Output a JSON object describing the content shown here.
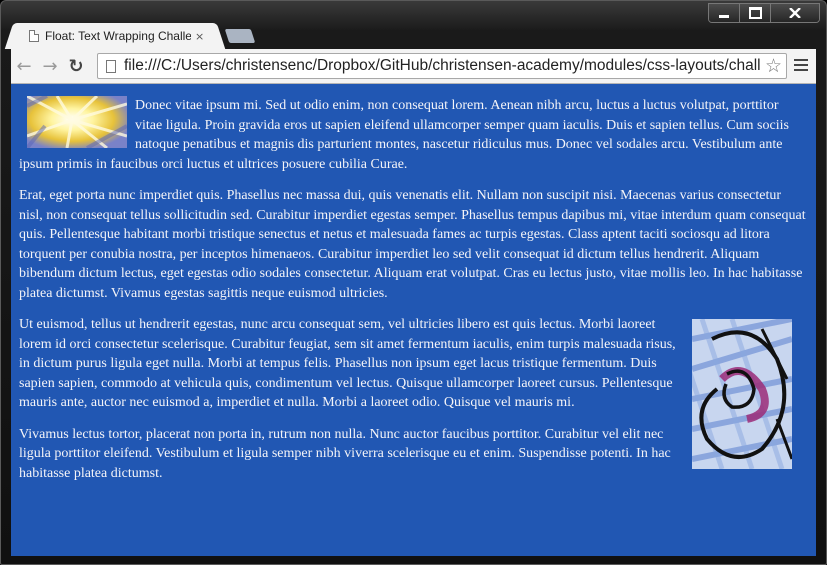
{
  "window": {
    "controls": {
      "minimize": "minimize",
      "maximize": "maximize",
      "close": "close"
    }
  },
  "tabs": [
    {
      "title": "Float: Text Wrapping Challe",
      "close": "×"
    }
  ],
  "toolbar": {
    "back": "←",
    "forward": "→",
    "reload": "↻",
    "url": "file:///C:/Users/christensenc/Dropbox/GitHub/christensen-academy/modules/css-layouts/chall",
    "bookmark": "☆"
  },
  "page": {
    "paragraphs": [
      "Donec vitae ipsum mi. Sed ut odio enim, non consequat lorem. Aenean nibh arcu, luctus a luctus volutpat, porttitor vitae ligula. Proin gravida eros ut sapien eleifend ullamcorper semper quam iaculis. Duis et sapien tellus. Cum sociis natoque penatibus et magnis dis parturient montes, nascetur ridiculus mus. Donec vel sodales arcu. Vestibulum ante ipsum primis in faucibus orci luctus et ultrices posuere cubilia Curae.",
      "Erat, eget porta nunc imperdiet quis. Phasellus nec massa dui, quis venenatis elit. Nullam non suscipit nisi. Maecenas varius consectetur nisl, non consequat tellus sollicitudin sed. Curabitur imperdiet egestas semper. Phasellus tempus dapibus mi, vitae interdum quam consequat quis. Pellentesque habitant morbi tristique senectus et netus et malesuada fames ac turpis egestas. Class aptent taciti sociosqu ad litora torquent per conubia nostra, per inceptos himenaeos. Curabitur imperdiet leo sed velit consequat id dictum tellus hendrerit. Aliquam bibendum dictum lectus, eget egestas odio sodales consectetur. Aliquam erat volutpat. Cras eu lectus justo, vitae mollis leo. In hac habitasse platea dictumst. Vivamus egestas sagittis neque euismod ultricies.",
      "Ut euismod, tellus ut hendrerit egestas, nunc arcu consequat sem, vel ultricies libero est quis lectus. Morbi laoreet lorem id orci consectetur scelerisque. Curabitur feugiat, sem sit amet fermentum iaculis, enim turpis malesuada risus, in dictum purus ligula eget nulla. Morbi at tempus felis. Phasellus non ipsum eget lacus tristique fermentum. Duis sapien sapien, commodo at vehicula quis, condimentum vel lectus. Quisque ullamcorper laoreet cursus. Pellentesque mauris ante, auctor nec euismod a, imperdiet et nulla. Morbi a laoreet odio. Quisque vel mauris mi.",
      "Vivamus lectus tortor, placerat non porta in, rutrum non nulla. Nunc auctor faucibus porttitor. Curabitur vel elit nec ligula porttitor eleifend. Vestibulum et ligula semper nibh viverra scelerisque eu et enim. Suspendisse potenti. In hac habitasse platea dictumst."
    ],
    "background": "#2157b3"
  }
}
